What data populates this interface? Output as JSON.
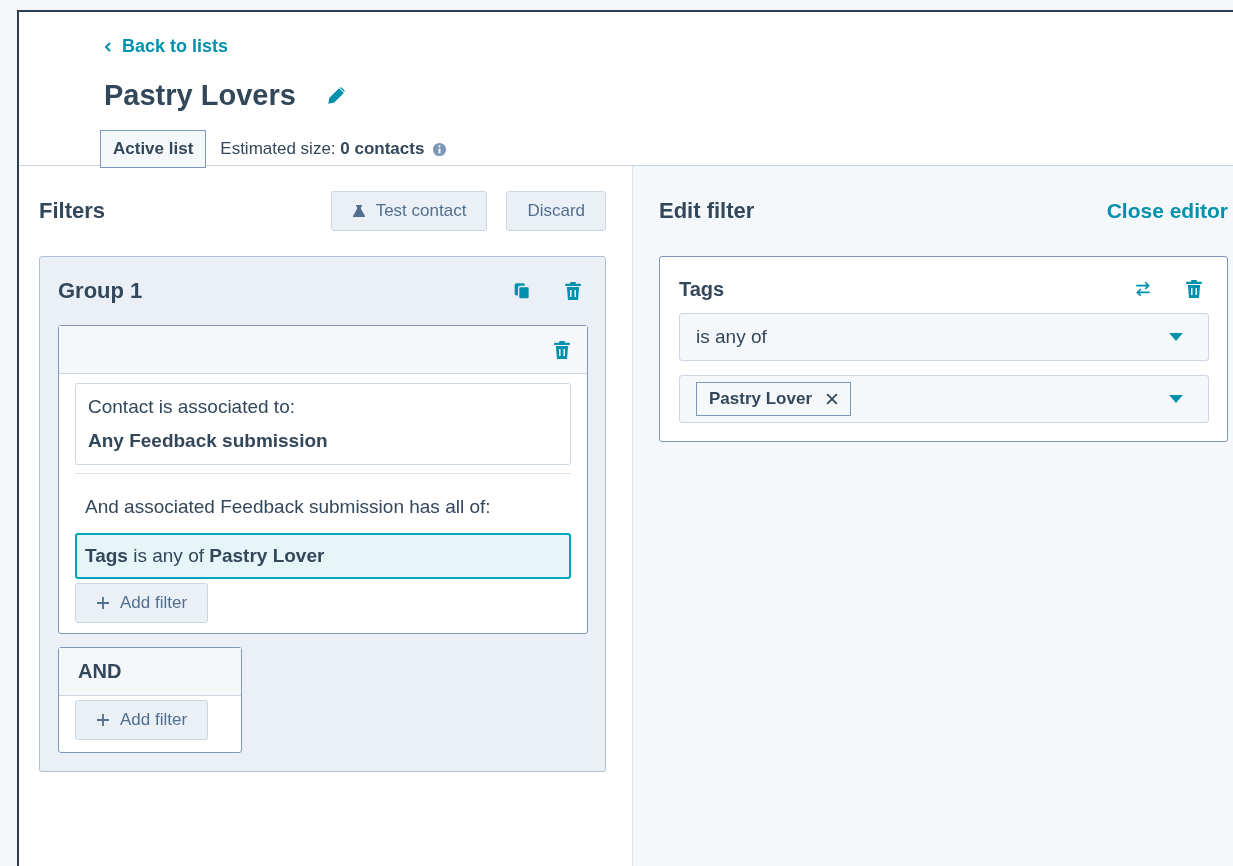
{
  "back_link": "Back to lists",
  "title": "Pastry Lovers",
  "list_type": "Active list",
  "estimated_size": "Estimated size: **0 contacts**",
  "filters": {
    "title": "Filters",
    "buttons": [
      {
        "label": "Test contact",
        "kind": "test"
      },
      {
        "label": "Discard",
        "kind": "plain"
      }
    ],
    "groups": [
      {
        "title": "Group 1",
        "association": {
          "label": "Contact is associated to:",
          "value": "Any Feedback submission"
        },
        "condition_text": "And associated Feedback submission has all of:",
        "conditions": [
          {
            "text": "**Tags** is any of **Pastry Lover**",
            "selected": true
          }
        ],
        "add_filter": "Add filter"
      }
    ],
    "and_block": {
      "label": "AND",
      "add_filter": "Add filter"
    }
  },
  "editor": {
    "title": "Edit filter",
    "close": "Close editor",
    "property": "Tags",
    "operator": "is any of",
    "values": [
      "Pastry Lover"
    ]
  }
}
